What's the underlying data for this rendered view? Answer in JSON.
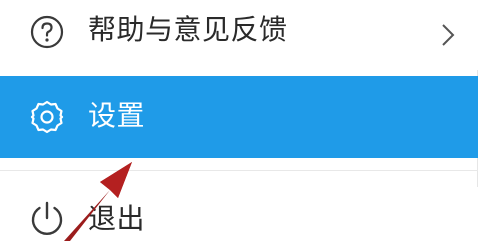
{
  "menu": {
    "items": [
      {
        "label": "帮助与意见反馈",
        "icon": "question-circle-icon",
        "has_submenu": true
      },
      {
        "label": "设置",
        "icon": "gear-icon",
        "selected": true
      },
      {
        "label": "退出",
        "icon": "power-icon"
      }
    ]
  },
  "colors": {
    "selected_background": "#1f9be8",
    "selected_text": "#ffffff",
    "text": "#2a2a2a",
    "annotation_arrow": "#9b1c1c"
  },
  "annotation": {
    "icon": "red-arrow-pointer"
  }
}
